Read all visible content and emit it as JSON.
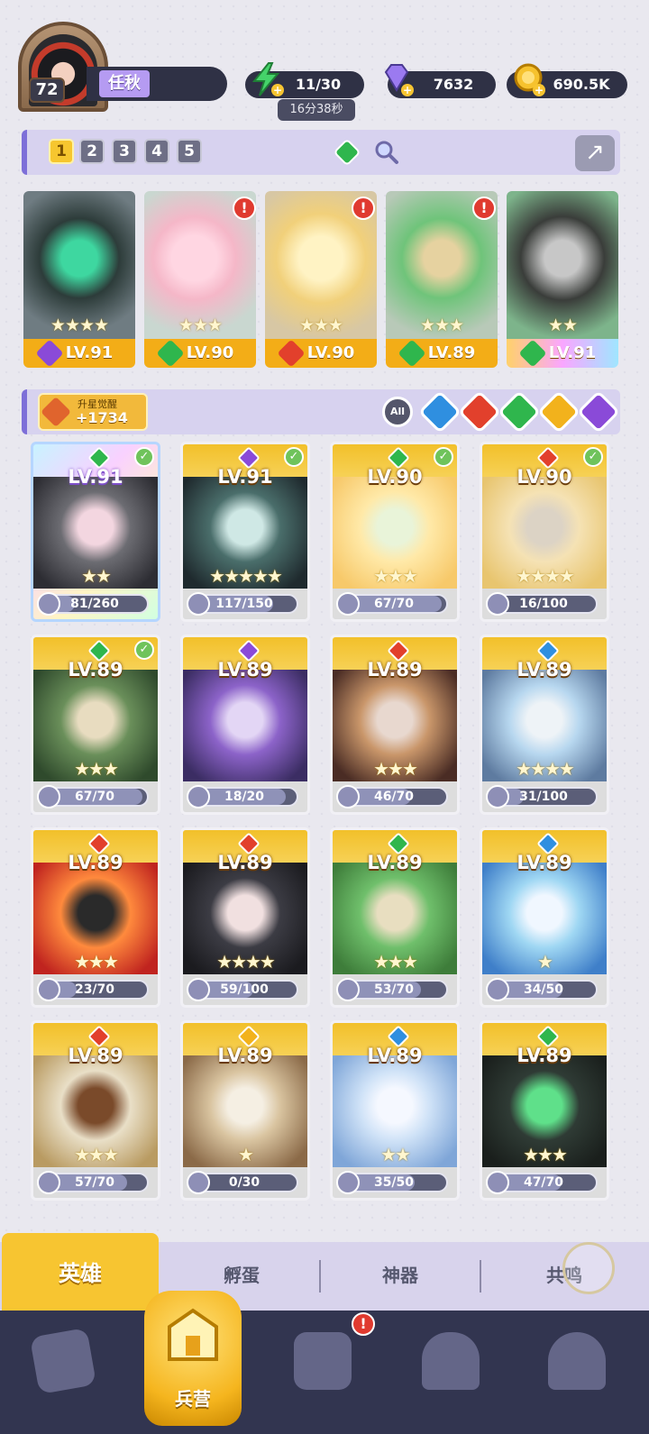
{
  "player": {
    "level": "72",
    "name": "任秋"
  },
  "resources": {
    "energy": "11/30",
    "energy_timer": "16分38秒",
    "gems": "7632",
    "gold": "690.5K"
  },
  "team_slots": [
    "1",
    "2",
    "3",
    "4",
    "5"
  ],
  "active_slot": 0,
  "team_cards": [
    {
      "level": "LV.91",
      "stars": "★★★★",
      "element": "dark",
      "alert": false
    },
    {
      "level": "LV.90",
      "stars": "★★★",
      "element": "wind",
      "alert": true
    },
    {
      "level": "LV.90",
      "stars": "★★★",
      "element": "fire",
      "alert": true
    },
    {
      "level": "LV.89",
      "stars": "★★★",
      "element": "wind",
      "alert": true
    },
    {
      "level": "LV.91",
      "stars": "★★",
      "element": "wind",
      "alert": false
    }
  ],
  "awaken": {
    "label": "升星觉醒",
    "value": "+1734"
  },
  "filters": {
    "all_label": "All",
    "elements": [
      "water",
      "fire",
      "wind",
      "light",
      "dark"
    ]
  },
  "heroes": [
    {
      "level": "LV.91",
      "progress": "81/260",
      "ratio": 0.31,
      "stars": "★★",
      "element": "wind",
      "checked": true,
      "special": true
    },
    {
      "level": "LV.91",
      "progress": "117/150",
      "ratio": 0.78,
      "stars": "★★★★★",
      "element": "dark",
      "checked": true,
      "special": false
    },
    {
      "level": "LV.90",
      "progress": "67/70",
      "ratio": 0.96,
      "stars": "★★★",
      "element": "wind",
      "checked": true,
      "special": false
    },
    {
      "level": "LV.90",
      "progress": "16/100",
      "ratio": 0.16,
      "stars": "★★★★",
      "element": "fire",
      "checked": true,
      "special": false
    },
    {
      "level": "LV.89",
      "progress": "67/70",
      "ratio": 0.96,
      "stars": "★★★",
      "element": "wind",
      "checked": true,
      "special": false
    },
    {
      "level": "LV.89",
      "progress": "18/20",
      "ratio": 0.9,
      "stars": "",
      "element": "dark",
      "checked": false,
      "special": false
    },
    {
      "level": "LV.89",
      "progress": "46/70",
      "ratio": 0.66,
      "stars": "★★★",
      "element": "fire",
      "checked": false,
      "special": false
    },
    {
      "level": "LV.89",
      "progress": "31/100",
      "ratio": 0.31,
      "stars": "★★★★",
      "element": "water",
      "checked": false,
      "special": false
    },
    {
      "level": "LV.89",
      "progress": "23/70",
      "ratio": 0.33,
      "stars": "★★★",
      "element": "fire",
      "checked": false,
      "special": false
    },
    {
      "level": "LV.89",
      "progress": "59/100",
      "ratio": 0.59,
      "stars": "★★★★",
      "element": "fire",
      "checked": false,
      "special": false
    },
    {
      "level": "LV.89",
      "progress": "53/70",
      "ratio": 0.76,
      "stars": "★★★",
      "element": "wind",
      "checked": false,
      "special": false
    },
    {
      "level": "LV.89",
      "progress": "34/50",
      "ratio": 0.68,
      "stars": "★",
      "element": "water",
      "checked": false,
      "special": false
    },
    {
      "level": "LV.89",
      "progress": "57/70",
      "ratio": 0.81,
      "stars": "★★★",
      "element": "fire",
      "checked": false,
      "special": false
    },
    {
      "level": "LV.89",
      "progress": "0/30",
      "ratio": 0,
      "stars": "★",
      "element": "light",
      "checked": false,
      "special": false
    },
    {
      "level": "LV.89",
      "progress": "35/50",
      "ratio": 0.7,
      "stars": "★★",
      "element": "water",
      "checked": false,
      "special": false
    },
    {
      "level": "LV.89",
      "progress": "47/70",
      "ratio": 0.67,
      "stars": "★★★",
      "element": "wind",
      "checked": false,
      "special": false
    }
  ],
  "subtabs": [
    "英雄",
    "孵蛋",
    "神器",
    "共鸣"
  ],
  "active_subtab": 0,
  "nav": {
    "active_label": "兵营",
    "alert_on_item": 2
  },
  "colors": {
    "fire": "#e2402c",
    "water": "#2f8fe0",
    "wind": "#2fb64d",
    "light": "#f2b21c",
    "dark": "#8a4ad8",
    "accent": "#f7c531",
    "nav_bg": "#323550"
  },
  "icons": {
    "energy": "lightning-icon",
    "gems": "diamond-icon",
    "gold": "coin-icon",
    "share": "share-icon",
    "search": "magnifier-icon",
    "awaken": "star-up-icon"
  }
}
